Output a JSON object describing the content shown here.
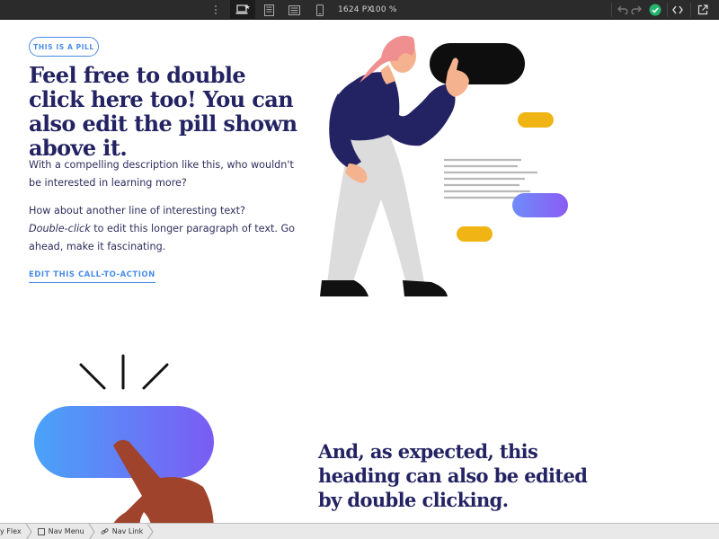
{
  "toolbar": {
    "size_readout": "1624 PX",
    "zoom_readout": "100 %",
    "icons": [
      "more-vertical-icon",
      "desktop-view-icon",
      "tablet-view-icon",
      "tablet-landscape-icon",
      "mobile-view-icon",
      "undo-icon",
      "redo-icon",
      "publish-check-icon",
      "code-icon",
      "export-icon"
    ],
    "accent": "#27b46e"
  },
  "hero": {
    "pill_label": "THIS IS A PILL",
    "heading": "Feel free to double click here too! You can also edit the pill shown above it.",
    "description_1": "With a compelling description like this, who wouldn't be interested in learning more?",
    "description_2_line1": "How about another line of interesting text?",
    "description_2_em": "Double-click",
    "description_2_rest": " to edit this longer paragraph of text. Go ahead, make it fascinating.",
    "cta_label": "EDIT THIS CALL-TO-ACTION"
  },
  "section2": {
    "heading": "And, as expected, this heading can also be edited by double clicking."
  },
  "breadcrumb": {
    "items": [
      {
        "label": "y Flex",
        "icon": ""
      },
      {
        "label": "Nav Menu",
        "icon": "box-icon"
      },
      {
        "label": "Nav Link",
        "icon": "link-icon"
      }
    ]
  },
  "colors": {
    "heading": "#232363",
    "accent_blue": "#4a8de8",
    "toolbar_bg": "#2b2b2b",
    "yellow": "#f0b514",
    "gradient_start": "#4aa3f8",
    "gradient_end": "#7b5cf4"
  }
}
